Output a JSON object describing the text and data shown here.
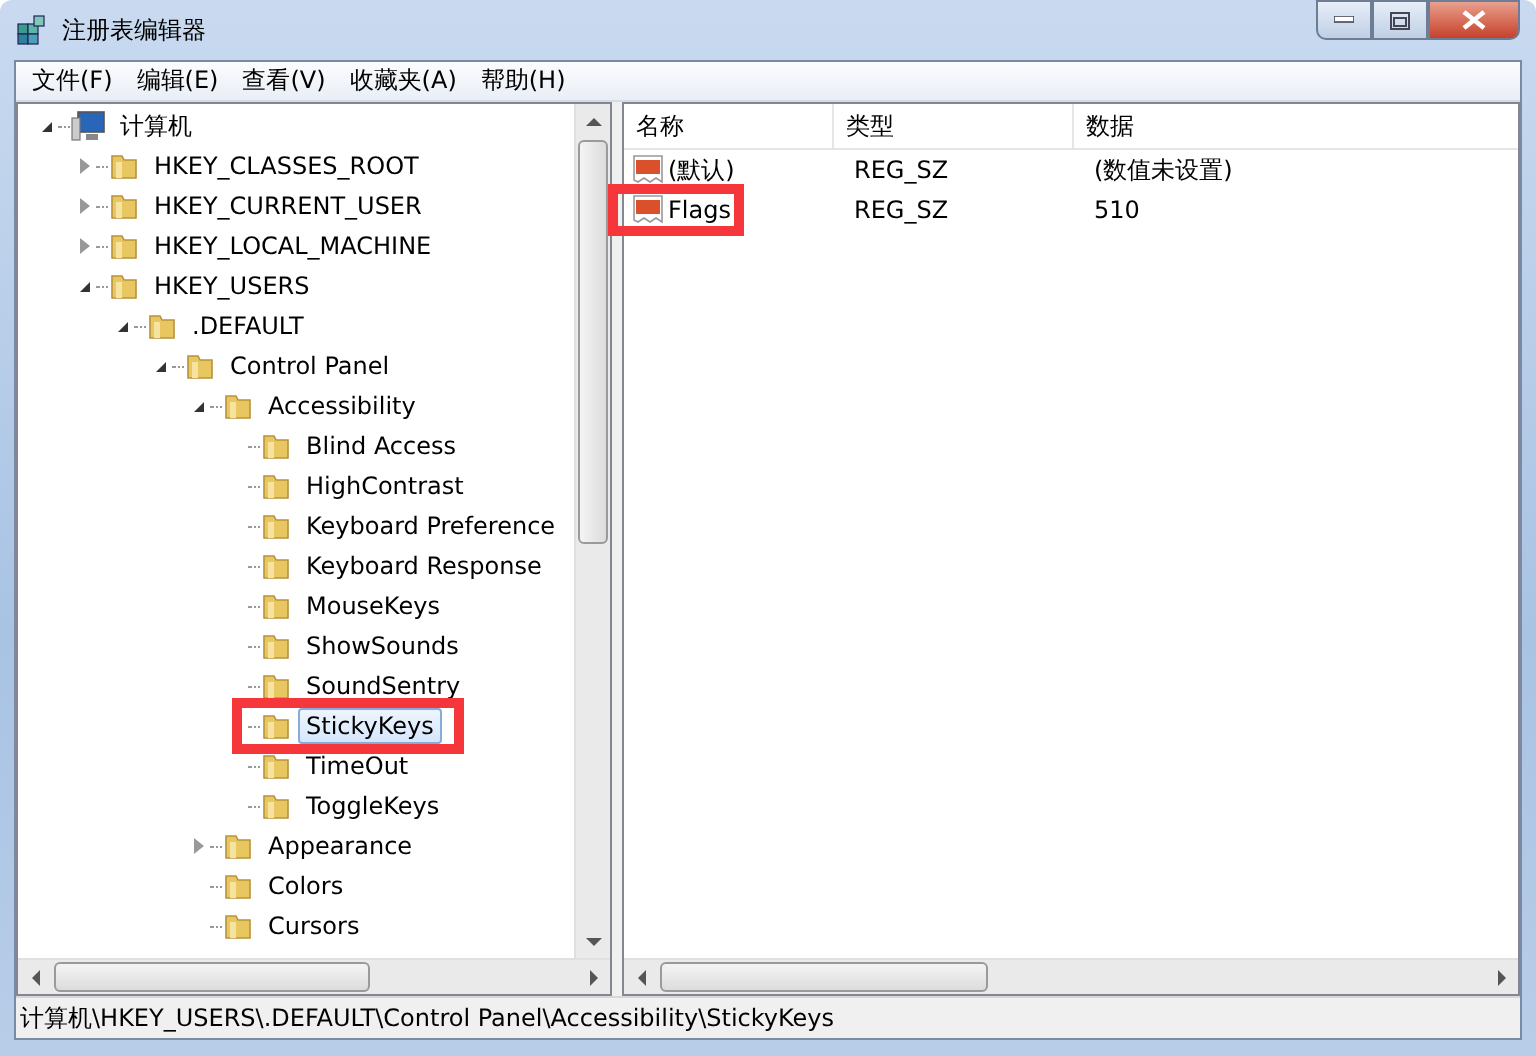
{
  "window": {
    "title": "注册表编辑器"
  },
  "menu": [
    "文件(F)",
    "编辑(E)",
    "查看(V)",
    "收藏夹(A)",
    "帮助(H)"
  ],
  "tree": [
    {
      "label": "计算机",
      "kind": "computer",
      "expanded": true,
      "selected": false,
      "highlighted": false,
      "children": [
        {
          "label": "HKEY_CLASSES_ROOT",
          "kind": "branch",
          "expanded": false,
          "selected": false,
          "highlighted": false
        },
        {
          "label": "HKEY_CURRENT_USER",
          "kind": "branch",
          "expanded": false,
          "selected": false,
          "highlighted": false
        },
        {
          "label": "HKEY_LOCAL_MACHINE",
          "kind": "branch",
          "expanded": false,
          "selected": false,
          "highlighted": false
        },
        {
          "label": "HKEY_USERS",
          "kind": "branch",
          "expanded": true,
          "selected": false,
          "highlighted": false,
          "children": [
            {
              "label": ".DEFAULT",
              "kind": "branch",
              "expanded": true,
              "selected": false,
              "highlighted": false,
              "children": [
                {
                  "label": "Control Panel",
                  "kind": "branch",
                  "expanded": true,
                  "selected": false,
                  "highlighted": false,
                  "children": [
                    {
                      "label": "Accessibility",
                      "kind": "branch",
                      "expanded": true,
                      "selected": false,
                      "highlighted": false,
                      "children": [
                        {
                          "label": "Blind Access",
                          "kind": "leaf",
                          "selected": false,
                          "highlighted": false
                        },
                        {
                          "label": "HighContrast",
                          "kind": "leaf",
                          "selected": false,
                          "highlighted": false
                        },
                        {
                          "label": "Keyboard Preference",
                          "kind": "leaf",
                          "selected": false,
                          "highlighted": false
                        },
                        {
                          "label": "Keyboard Response",
                          "kind": "leaf",
                          "selected": false,
                          "highlighted": false
                        },
                        {
                          "label": "MouseKeys",
                          "kind": "leaf",
                          "selected": false,
                          "highlighted": false
                        },
                        {
                          "label": "ShowSounds",
                          "kind": "leaf",
                          "selected": false,
                          "highlighted": false
                        },
                        {
                          "label": "SoundSentry",
                          "kind": "leaf",
                          "selected": false,
                          "highlighted": false
                        },
                        {
                          "label": "StickyKeys",
                          "kind": "leaf",
                          "selected": true,
                          "highlighted": true
                        },
                        {
                          "label": "TimeOut",
                          "kind": "leaf",
                          "selected": false,
                          "highlighted": false
                        },
                        {
                          "label": "ToggleKeys",
                          "kind": "leaf",
                          "selected": false,
                          "highlighted": false
                        }
                      ]
                    },
                    {
                      "label": "Appearance",
                      "kind": "branch",
                      "expanded": false,
                      "selected": false,
                      "highlighted": false
                    },
                    {
                      "label": "Colors",
                      "kind": "leaf",
                      "selected": false,
                      "highlighted": false
                    },
                    {
                      "label": "Cursors",
                      "kind": "leaf",
                      "selected": false,
                      "highlighted": false
                    }
                  ]
                }
              ]
            }
          ]
        }
      ]
    }
  ],
  "values": {
    "columns": [
      "名称",
      "类型",
      "数据"
    ],
    "rows": [
      {
        "name": "(默认)",
        "type": "REG_SZ",
        "data": "(数值未设置)",
        "highlighted": false
      },
      {
        "name": "Flags",
        "type": "REG_SZ",
        "data": "510",
        "highlighted": true
      }
    ]
  },
  "status_bar": "计算机\\HKEY_USERS\\.DEFAULT\\Control Panel\\Accessibility\\StickyKeys"
}
